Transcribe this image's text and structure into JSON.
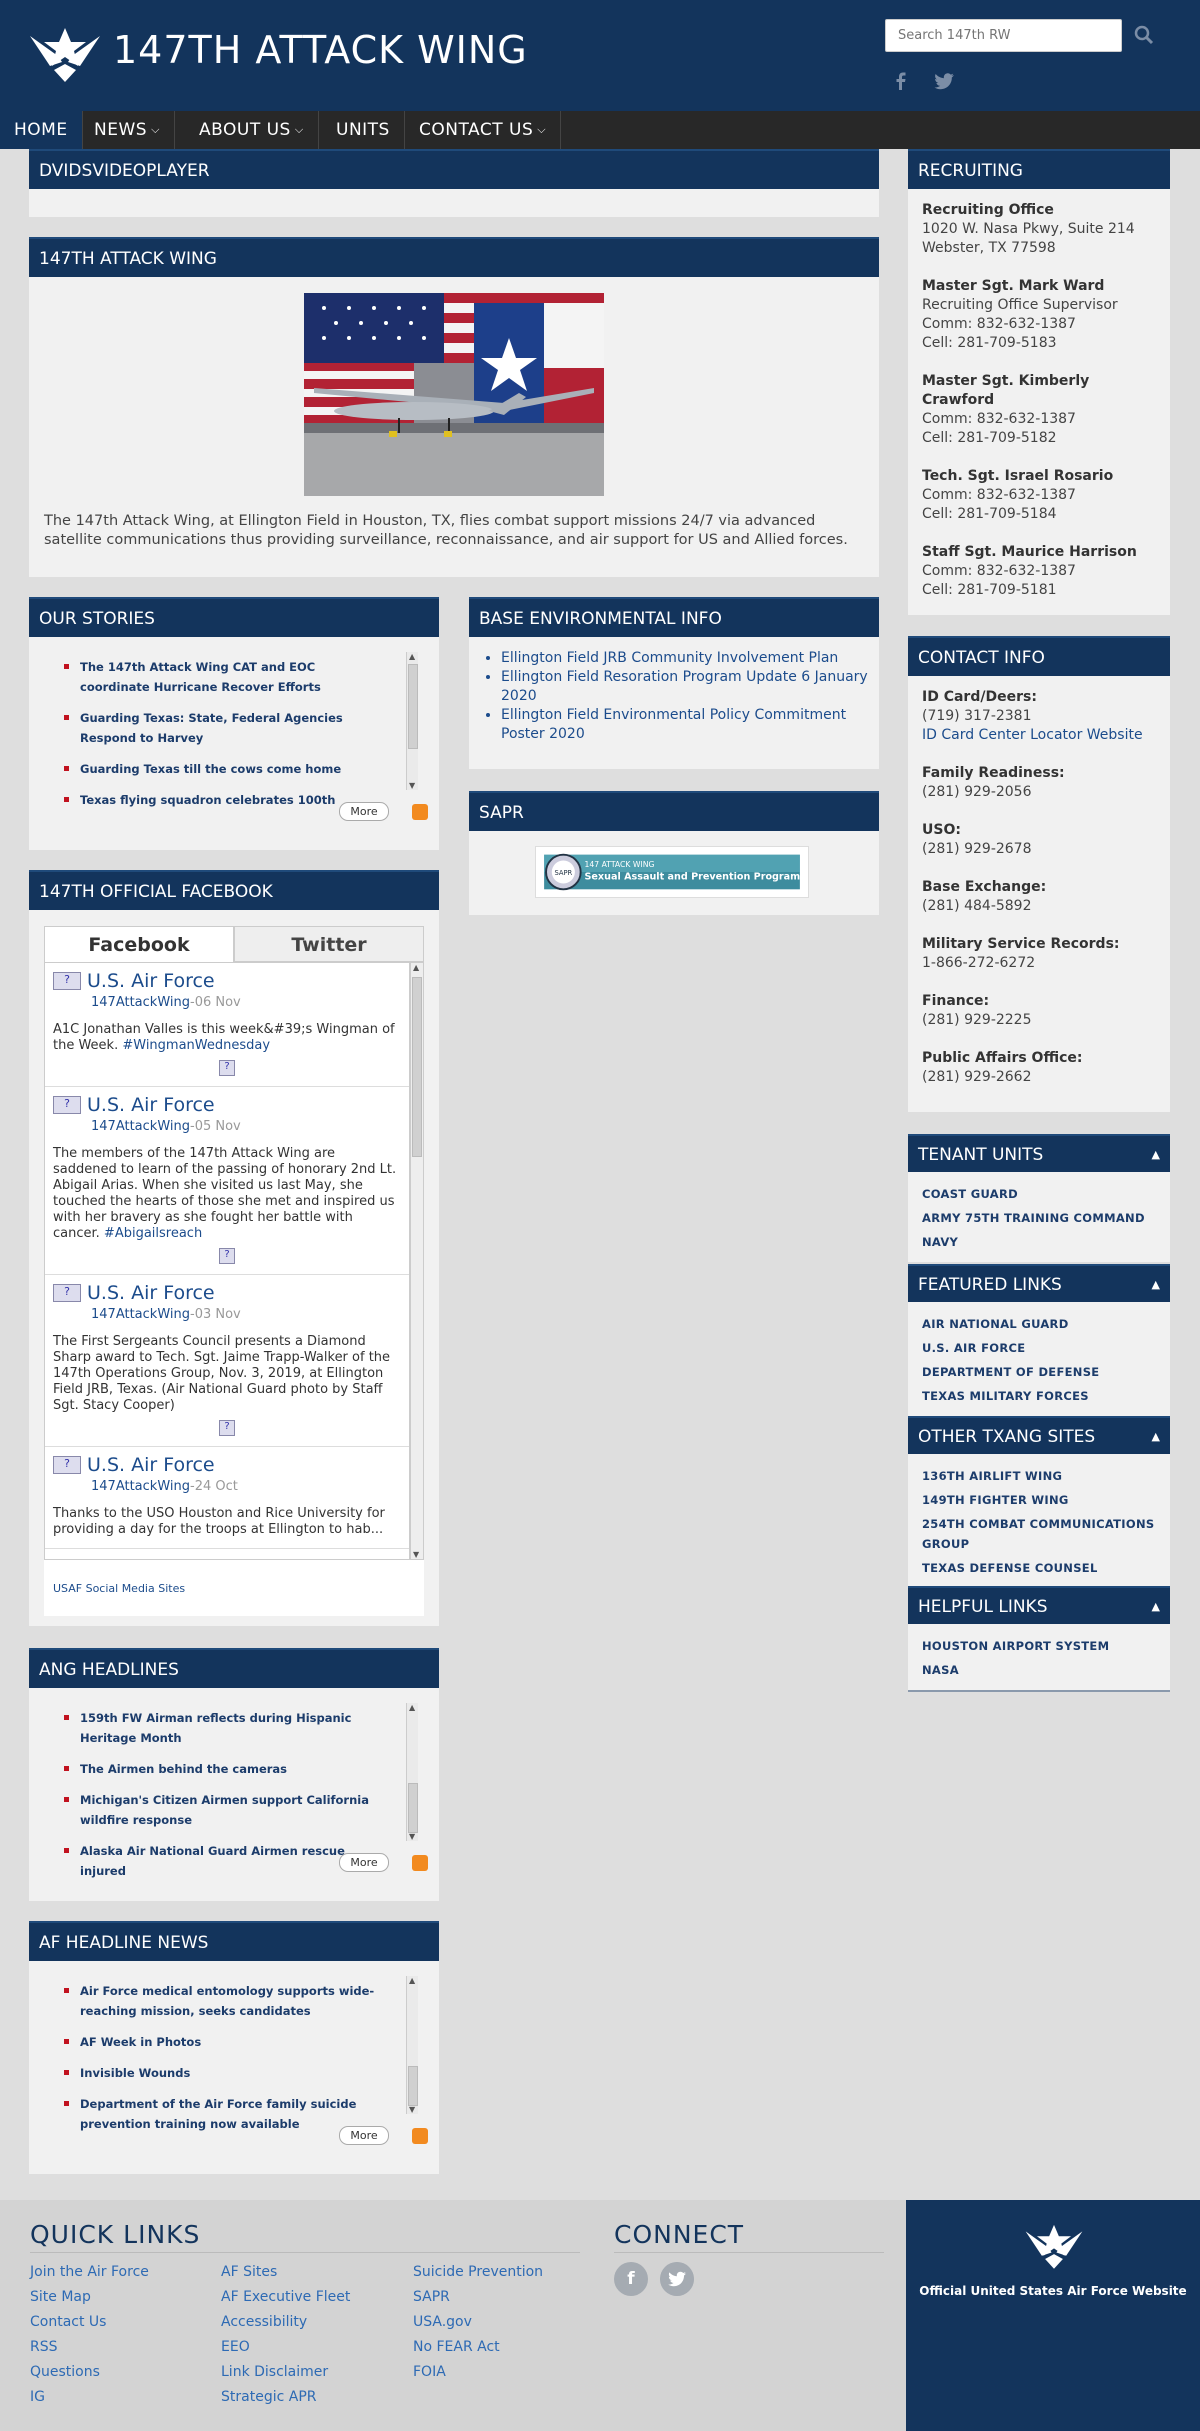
{
  "header": {
    "title": "147TH ATTACK WING",
    "search_placeholder": "Search 147th RW"
  },
  "nav": {
    "items": [
      {
        "label": "HOME",
        "has_menu": false
      },
      {
        "label": "NEWS",
        "has_menu": true
      },
      {
        "label": "ABOUT US",
        "has_menu": true
      },
      {
        "label": "UNITS",
        "has_menu": false
      },
      {
        "label": "CONTACT US",
        "has_menu": true
      }
    ]
  },
  "dvids": {
    "title": "DVIDSVIDEOPLAYER"
  },
  "about": {
    "title": "147TH ATTACK WING",
    "text": "The 147th Attack Wing, at Ellington Field in Houston, TX, flies combat support missions 24/7 via advanced satellite communications thus providing surveillance, reconnaissance, and air support for US and Allied forces."
  },
  "stories": {
    "title": "OUR STORIES",
    "items": [
      "The 147th Attack Wing CAT and EOC coordinate Hurricane Recover Efforts",
      "Guarding Texas: State, Federal Agencies Respond to Harvey",
      "Guarding Texas till the cows come home",
      "Texas flying squadron celebrates 100th"
    ],
    "more": "More"
  },
  "env": {
    "title": "BASE ENVIRONMENTAL INFO",
    "items": [
      "Ellington Field JRB Community Involvement Plan",
      "Ellington Field Resoration Program Update 6 January 2020",
      "Ellington Field Environmental Policy Commitment Poster 2020"
    ]
  },
  "sapr": {
    "title": "SAPR",
    "banner_line1": "147 ATTACK WING",
    "banner_line2": "Sexual Assault and Prevention Program",
    "badge": "SAPR"
  },
  "facebook": {
    "title": "147TH OFFICIAL FACEBOOK",
    "tab_facebook": "Facebook",
    "tab_twitter": "Twitter",
    "posts": [
      {
        "name": "U.S. Air Force",
        "handle": "147AttackWing",
        "date": "-06 Nov",
        "text": "A1C Jonathan Valles is this week&#39;s Wingman of the Week. ",
        "tag": "#WingmanWednesday"
      },
      {
        "name": "U.S. Air Force",
        "handle": "147AttackWing",
        "date": "-05 Nov",
        "text": "The members of the 147th Attack Wing are saddened to learn of the passing of honorary 2nd Lt. Abigail Arias. When she visited us last May, she touched the hearts of those she met and inspired us with her bravery as she fought her battle with cancer. ",
        "tag": "#Abigailsreach"
      },
      {
        "name": "U.S. Air Force",
        "handle": "147AttackWing",
        "date": "-03 Nov",
        "text": "The First Sergeants Council presents a Diamond Sharp award to Tech. Sgt. Jaime Trapp-Walker of the 147th Operations Group, Nov. 3, 2019, at Ellington Field JRB, Texas. (Air National Guard photo by Staff Sgt. Stacy Cooper)",
        "tag": ""
      },
      {
        "name": "U.S. Air Force",
        "handle": "147AttackWing",
        "date": "-24 Oct",
        "text": "Thanks to the USO Houston and Rice University for providing a day for the troops at Ellington to hab...",
        "tag": ""
      }
    ],
    "footer_link": "USAF Social Media Sites"
  },
  "ang": {
    "title": "ANG HEADLINES",
    "items": [
      "159th FW Airman reflects during Hispanic Heritage Month",
      "The Airmen behind the cameras",
      "Michigan's Citizen Airmen support California wildfire response",
      "Alaska Air National Guard Airmen rescue injured"
    ],
    "more": "More"
  },
  "afnews": {
    "title": "AF HEADLINE NEWS",
    "items": [
      "Air Force medical entomology supports wide-reaching mission, seeks candidates",
      "AF Week in Photos",
      "Invisible Wounds",
      "Department of the Air Force family suicide prevention training now available"
    ],
    "more": "More"
  },
  "recruiting": {
    "title": "RECRUITING",
    "blocks": [
      {
        "label": "Recruiting Office",
        "lines": [
          "1020 W. Nasa Pkwy, Suite 214",
          "Webster, TX 77598"
        ]
      },
      {
        "label": "Master Sgt. Mark Ward",
        "lines": [
          "Recruiting Office Supervisor",
          "Comm: 832-632-1387",
          "Cell: 281-709-5183"
        ]
      },
      {
        "label": "Master Sgt. Kimberly Crawford",
        "lines": [
          "Comm: 832-632-1387",
          "Cell: 281-709-5182"
        ]
      },
      {
        "label": "Tech. Sgt. Israel Rosario",
        "lines": [
          "Comm: 832-632-1387",
          "Cell: 281-709-5184"
        ]
      },
      {
        "label": "Staff Sgt. Maurice Harrison",
        "lines": [
          "Comm: 832-632-1387",
          "Cell: 281-709-5181"
        ]
      }
    ]
  },
  "contact": {
    "title": "CONTACT INFO",
    "blocks": [
      {
        "label": "ID Card/Deers:",
        "line": "(719) 317-2381",
        "link": "ID Card Center Locator Website"
      },
      {
        "label": "Family Readiness:",
        "line": "(281) 929-2056"
      },
      {
        "label": "USO:",
        "line": "(281) 929-2678"
      },
      {
        "label": "Base Exchange:",
        "line": "(281) 484-5892"
      },
      {
        "label": "Military Service Records:",
        "line": "1-866-272-6272"
      },
      {
        "label": "Finance:",
        "line": "(281) 929-2225"
      },
      {
        "label": "Public Affairs Office:",
        "line": "(281) 929-2662"
      }
    ]
  },
  "tenant": {
    "title": "TENANT UNITS",
    "items": [
      "COAST GUARD",
      "ARMY 75TH TRAINING COMMAND",
      "NAVY"
    ]
  },
  "featured": {
    "title": "FEATURED LINKS",
    "items": [
      "AIR NATIONAL GUARD",
      "U.S. AIR FORCE",
      "DEPARTMENT OF DEFENSE",
      "TEXAS MILITARY FORCES"
    ]
  },
  "txang": {
    "title": "OTHER TXANG SITES",
    "items": [
      "136TH AIRLIFT WING",
      "149TH FIGHTER WING",
      "254TH COMBAT COMMUNICATIONS GROUP",
      "TEXAS DEFENSE COUNSEL"
    ]
  },
  "helpful": {
    "title": "HELPFUL LINKS",
    "items": [
      "HOUSTON AIRPORT SYSTEM",
      "NASA"
    ]
  },
  "footer": {
    "quick_links_title": "QUICK LINKS",
    "connect_title": "CONNECT",
    "col1": [
      "Join the Air Force",
      "Site Map",
      "Contact Us",
      "RSS",
      "Questions",
      "IG"
    ],
    "col2": [
      "AF Sites",
      "AF Executive Fleet",
      "Accessibility",
      "EEO",
      "Link Disclaimer",
      "Strategic APR"
    ],
    "col3": [
      "Suicide Prevention",
      "SAPR",
      "USA.gov",
      "No FEAR Act",
      "FOIA"
    ],
    "af_text": "Official United States Air Force Website"
  },
  "colors": {
    "brand": "#13345c",
    "nav": "#282828",
    "link": "#1c4c8c",
    "bullet": "#c1121f"
  }
}
